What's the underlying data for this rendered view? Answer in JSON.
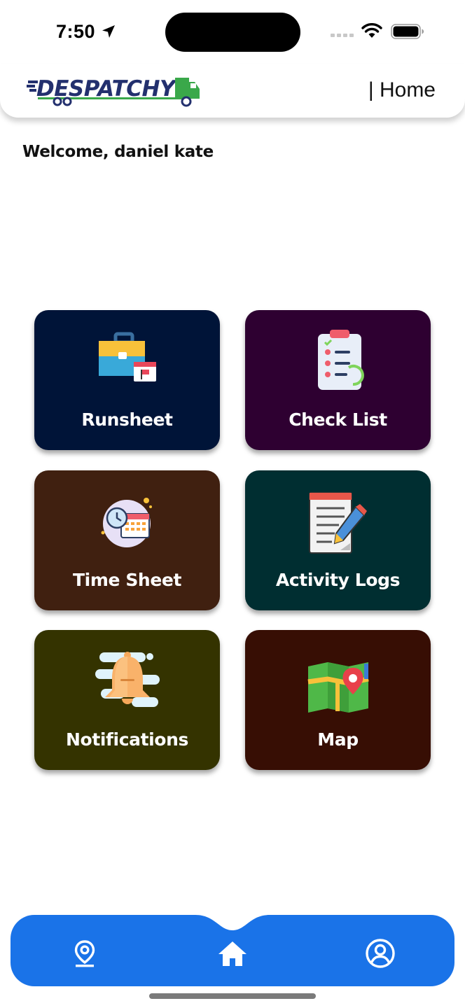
{
  "status_bar": {
    "time": "7:50"
  },
  "header": {
    "logo_text": "DESPATCHY",
    "title": "| Home"
  },
  "welcome": "Welcome, daniel kate",
  "tiles": [
    {
      "label": "Runsheet",
      "color": "#001438",
      "icon": "briefcase-calendar-icon"
    },
    {
      "label": "Check List",
      "color": "#2e0031",
      "icon": "clipboard-checklist-icon"
    },
    {
      "label": "Time Sheet",
      "color": "#402010",
      "icon": "clock-calendar-icon"
    },
    {
      "label": "Activity Logs",
      "color": "#002e31",
      "icon": "notepad-pencil-icon"
    },
    {
      "label": "Notifications",
      "color": "#343300",
      "icon": "bell-icon"
    },
    {
      "label": "Map",
      "color": "#370e04",
      "icon": "map-pin-icon"
    }
  ],
  "bottom_nav": {
    "color": "#1a73e8",
    "items": [
      {
        "name": "location",
        "icon": "location-pin-icon"
      },
      {
        "name": "home",
        "icon": "home-icon"
      },
      {
        "name": "profile",
        "icon": "user-circle-icon"
      }
    ]
  }
}
